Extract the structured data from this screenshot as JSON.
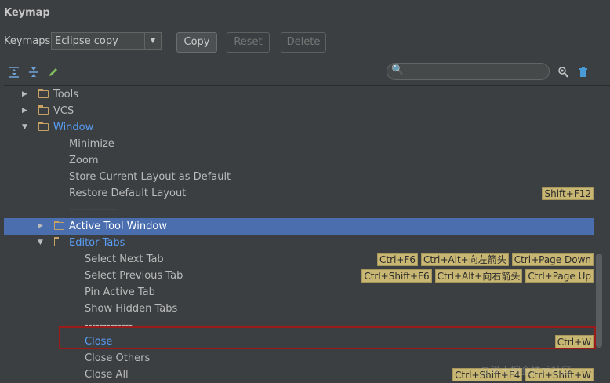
{
  "dialog": {
    "title": "Keymap"
  },
  "keymap_select": {
    "label": "Keymaps:",
    "value": "Eclipse copy"
  },
  "buttons": {
    "copy": "Copy",
    "reset": "Reset",
    "delete": "Delete"
  },
  "search": {
    "value": "",
    "placeholder": ""
  },
  "tree": [
    {
      "label": "Tools",
      "folder": true,
      "expanded": false,
      "shortcuts": []
    },
    {
      "label": "VCS",
      "folder": true,
      "expanded": false,
      "shortcuts": []
    },
    {
      "label": "Window",
      "folder": true,
      "expanded": true,
      "shortcuts": []
    },
    {
      "label": "Minimize",
      "shortcuts": []
    },
    {
      "label": "Zoom",
      "shortcuts": []
    },
    {
      "label": "Store Current Layout as Default",
      "shortcuts": []
    },
    {
      "label": "Restore Default Layout",
      "shortcuts": [
        "Shift+F12"
      ]
    },
    {
      "label": "-------------",
      "shortcuts": []
    },
    {
      "label": "Active Tool Window",
      "folder": true,
      "expanded": false,
      "shortcuts": []
    },
    {
      "label": "Editor Tabs",
      "folder": true,
      "expanded": true,
      "shortcuts": []
    },
    {
      "label": "Select Next Tab",
      "shortcuts": [
        "Ctrl+F6",
        "Ctrl+Alt+向左箭头",
        "Ctrl+Page Down"
      ]
    },
    {
      "label": "Select Previous Tab",
      "shortcuts": [
        "Ctrl+Shift+F6",
        "Ctrl+Alt+向右箭头",
        "Ctrl+Page Up"
      ]
    },
    {
      "label": "Pin Active Tab",
      "shortcuts": []
    },
    {
      "label": "Show Hidden Tabs",
      "shortcuts": []
    },
    {
      "label": "-------------",
      "shortcuts": []
    },
    {
      "label": "Close",
      "shortcuts": [
        "Ctrl+W"
      ]
    },
    {
      "label": "Close Others",
      "shortcuts": []
    },
    {
      "label": "Close All",
      "shortcuts": [
        "Ctrl+Shift+F4",
        "Ctrl+Shift+W"
      ]
    }
  ],
  "watermark": "@稀土掘金技术社区",
  "colors": {
    "selection": "#4b6eaf",
    "shortcut_bg": "#c8b673",
    "highlight_border": "#9b1b1b",
    "link_blue": "#589df6"
  }
}
